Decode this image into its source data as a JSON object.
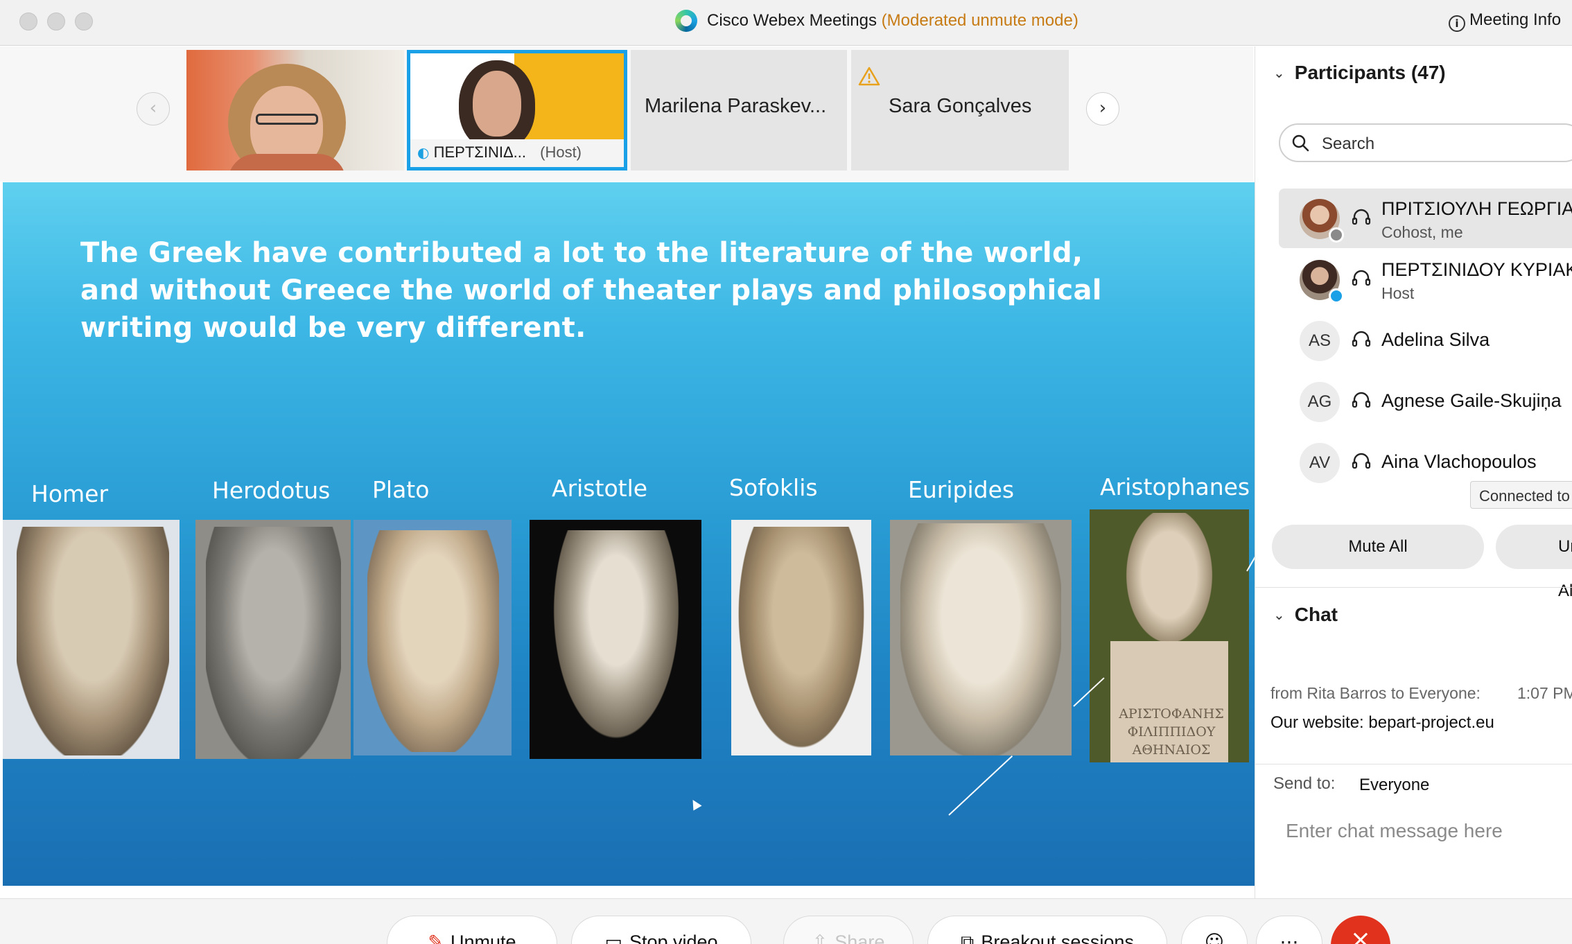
{
  "window": {
    "title": "Cisco Webex Meetings",
    "mode": "(Moderated unmute mode)",
    "meeting_info": "Meeting Info"
  },
  "thumbnails": [
    {
      "name": "",
      "type": "video"
    },
    {
      "name": "ΠΕΡΤΣΙΝΙΔ...",
      "role": "(Host)",
      "type": "video",
      "active": true
    },
    {
      "name": "Marilena Paraskev...",
      "type": "name-only"
    },
    {
      "name": "Sara Gonçalves",
      "type": "name-only",
      "warning": true
    }
  ],
  "slide": {
    "text": "The Greek have contributed a lot to the literature of the world, and without Greece the world of theater plays and philosophical writing would be very different.",
    "figures": [
      "Homer",
      "Herodotus",
      "Plato",
      "Aristotle",
      "Sofoklis",
      "Euripides",
      "Aristophanes"
    ],
    "aristophanes_inscription": [
      "ΑΡΙΣΤΟΦΑΝΗΣ",
      "ΦΙΛΙΠΠΙΔΟΥ",
      "ΑΘΗΝΑΙΟΣ"
    ]
  },
  "participants": {
    "header": "Participants (47)",
    "search_placeholder": "Search",
    "list": [
      {
        "name": "ΠΡΙΤΣΙΟΥΛΗ ΓΕΩΡΓΙΑ",
        "role": "Cohost, me",
        "initials": "",
        "selected": true
      },
      {
        "name": "ΠΕΡΤΣΙΝΙΔΟΥ ΚΥΡΙΑΚΗ",
        "role": "Host",
        "initials": ""
      },
      {
        "name": "Adelina Silva",
        "role": "",
        "initials": "AS"
      },
      {
        "name": "Agnese Gaile-Skujiņa",
        "role": "",
        "initials": "AG"
      },
      {
        "name": "Aina Vlachopoulos",
        "role": "",
        "initials": "AV"
      }
    ],
    "tooltip": "Connected to",
    "mute_all": "Mute All",
    "unmute_all": "Unmute All"
  },
  "chat": {
    "header": "Chat",
    "from": "from Rita Barros to Everyone:",
    "time": "1:07 PM",
    "message": "Our website: bepart-project.eu",
    "send_to_label": "Send to:",
    "send_to_value": "Everyone",
    "input_placeholder": "Enter chat message here"
  },
  "controls": {
    "unmute": "Unmute",
    "stop_video": "Stop video",
    "share": "Share",
    "breakout": "Breakout sessions"
  },
  "colors": {
    "accent_blue": "#19a0e6",
    "mode_orange": "#c77b14",
    "end_red": "#e0321d"
  }
}
